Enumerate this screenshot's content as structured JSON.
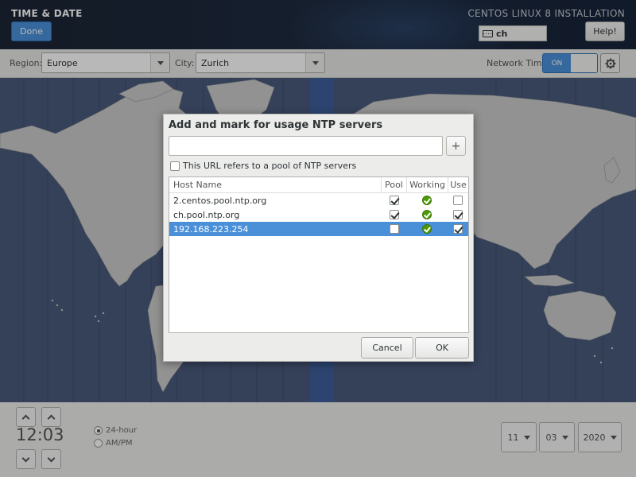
{
  "header": {
    "spoke_title": "TIME & DATE",
    "done_label": "Done",
    "product_title": "CENTOS LINUX 8 INSTALLATION",
    "keyboard_layout": "ch",
    "help_label": "Help!"
  },
  "toolbar": {
    "region_label": "Region:",
    "region_value": "Europe",
    "city_label": "City:",
    "city_value": "Zurich",
    "network_time_label": "Network Time",
    "network_time_state": "ON"
  },
  "dialog": {
    "title": "Add and mark for usage NTP servers",
    "url_value": "",
    "add_label": "+",
    "pool_checkbox_label": "This URL refers to a pool of NTP servers",
    "pool_checkbox_checked": false,
    "columns": {
      "host": "Host Name",
      "pool": "Pool",
      "working": "Working",
      "use": "Use"
    },
    "servers": [
      {
        "host": "2.centos.pool.ntp.org",
        "pool": true,
        "working": true,
        "use": false
      },
      {
        "host": "ch.pool.ntp.org",
        "pool": true,
        "working": true,
        "use": true
      },
      {
        "host": "192.168.223.254",
        "pool": false,
        "working": true,
        "use": true
      }
    ],
    "selected_index": 2,
    "cancel_label": "Cancel",
    "ok_label": "OK"
  },
  "time": {
    "clock": "12:03",
    "format_24": "24-hour",
    "format_ampm": "AM/PM",
    "selected_format": "24-hour"
  },
  "date": {
    "month": "11",
    "day": "03",
    "year": "2020"
  },
  "colors": {
    "accent": "#4a90d9",
    "header_bg": "#1e2b40",
    "ok_green": "#4e9a06",
    "map_ocean": "#4a5a7c",
    "map_land": "#c9cbc9"
  }
}
